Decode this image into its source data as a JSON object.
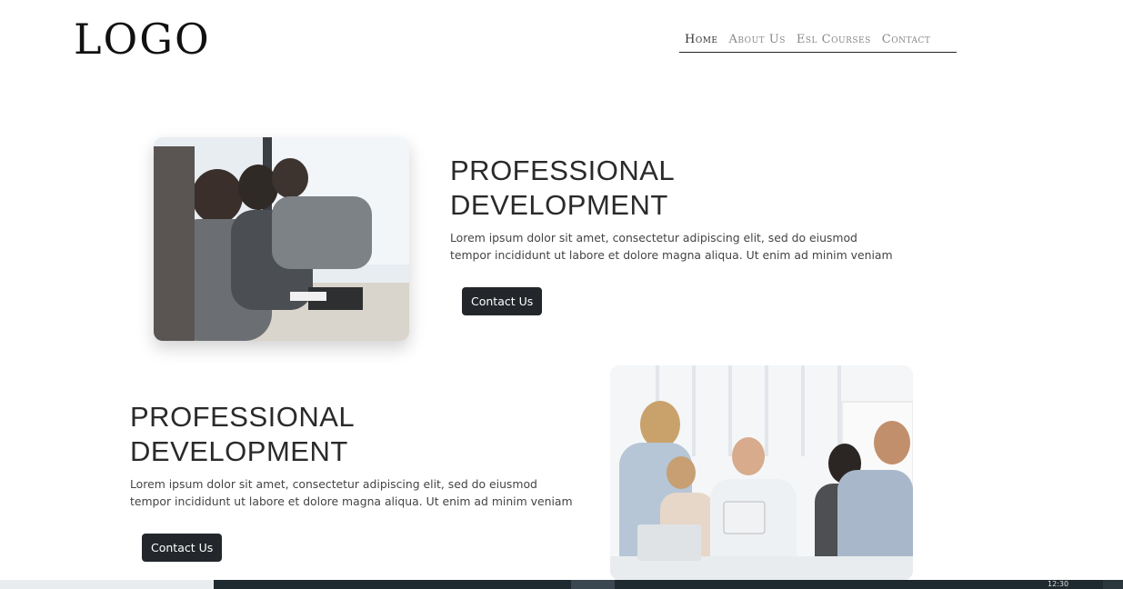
{
  "header": {
    "logo": "LOGO",
    "nav": [
      {
        "label": "Home",
        "active": true
      },
      {
        "label": "About Us",
        "active": false
      },
      {
        "label": "Esl Courses",
        "active": false
      },
      {
        "label": "Contact",
        "active": false
      }
    ]
  },
  "sections": [
    {
      "title_line1": "PROFESSIONAL",
      "title_line2": "DEVELOPMENT",
      "text_line1": "Lorem ipsum dolor sit amet, consectetur adipiscing elit, sed do eiusmod",
      "text_line2": "tempor incididunt ut labore et dolore magna aliqua. Ut enim ad minim veniam",
      "button": "Contact Us"
    },
    {
      "title_line1": "PROFESSIONAL",
      "title_line2": "DEVELOPMENT",
      "text_line1": "Lorem ipsum dolor sit amet, consectetur adipiscing elit, sed do eiusmod",
      "text_line2": "tempor incididunt ut labore et dolore magna aliqua. Ut enim ad minim veniam",
      "button": "Contact Us"
    }
  ],
  "taskbar": {
    "clock": "12:30"
  }
}
